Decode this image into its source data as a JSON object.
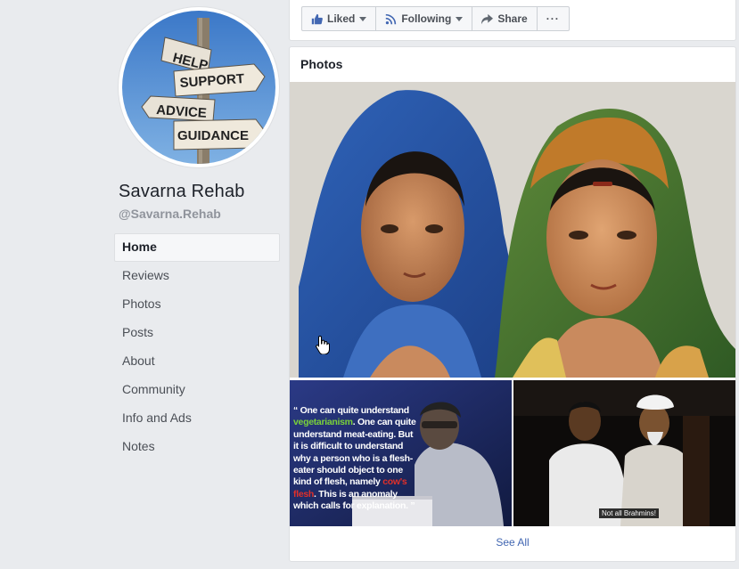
{
  "page": {
    "name": "Savarna Rehab",
    "handle": "@Savarna.Rehab"
  },
  "profile_sign": {
    "signs": [
      "HELP",
      "SUPPORT",
      "ADVICE",
      "GUIDANCE"
    ]
  },
  "nav": {
    "items": [
      {
        "label": "Home",
        "active": true
      },
      {
        "label": "Reviews"
      },
      {
        "label": "Photos"
      },
      {
        "label": "Posts"
      },
      {
        "label": "About"
      },
      {
        "label": "Community"
      },
      {
        "label": "Info and Ads"
      },
      {
        "label": "Notes"
      }
    ]
  },
  "actions": {
    "liked": "Liked",
    "following": "Following",
    "share": "Share",
    "more": "···"
  },
  "photos": {
    "title": "Photos",
    "quote_open": "“",
    "quote_parts": [
      "One can quite understand ",
      "vegetarianism",
      ". One can quite understand meat-eating. But it is difficult to understand why a person who is a flesh-eater should object to one kind of flesh, namely ",
      "cow's flesh",
      ". This is an anomaly which calls for explanation. ”"
    ],
    "caption": "Not all Brahmins!",
    "see_all": "See All"
  },
  "colors": {
    "background": "#e9ebee",
    "link": "#4267b2",
    "accent_green": "#7ad13a",
    "accent_red": "#e0302a"
  },
  "icons": [
    "thumbs-up-icon",
    "rss-icon",
    "share-arrow-icon",
    "more-dots-icon",
    "hand-cursor-icon"
  ]
}
